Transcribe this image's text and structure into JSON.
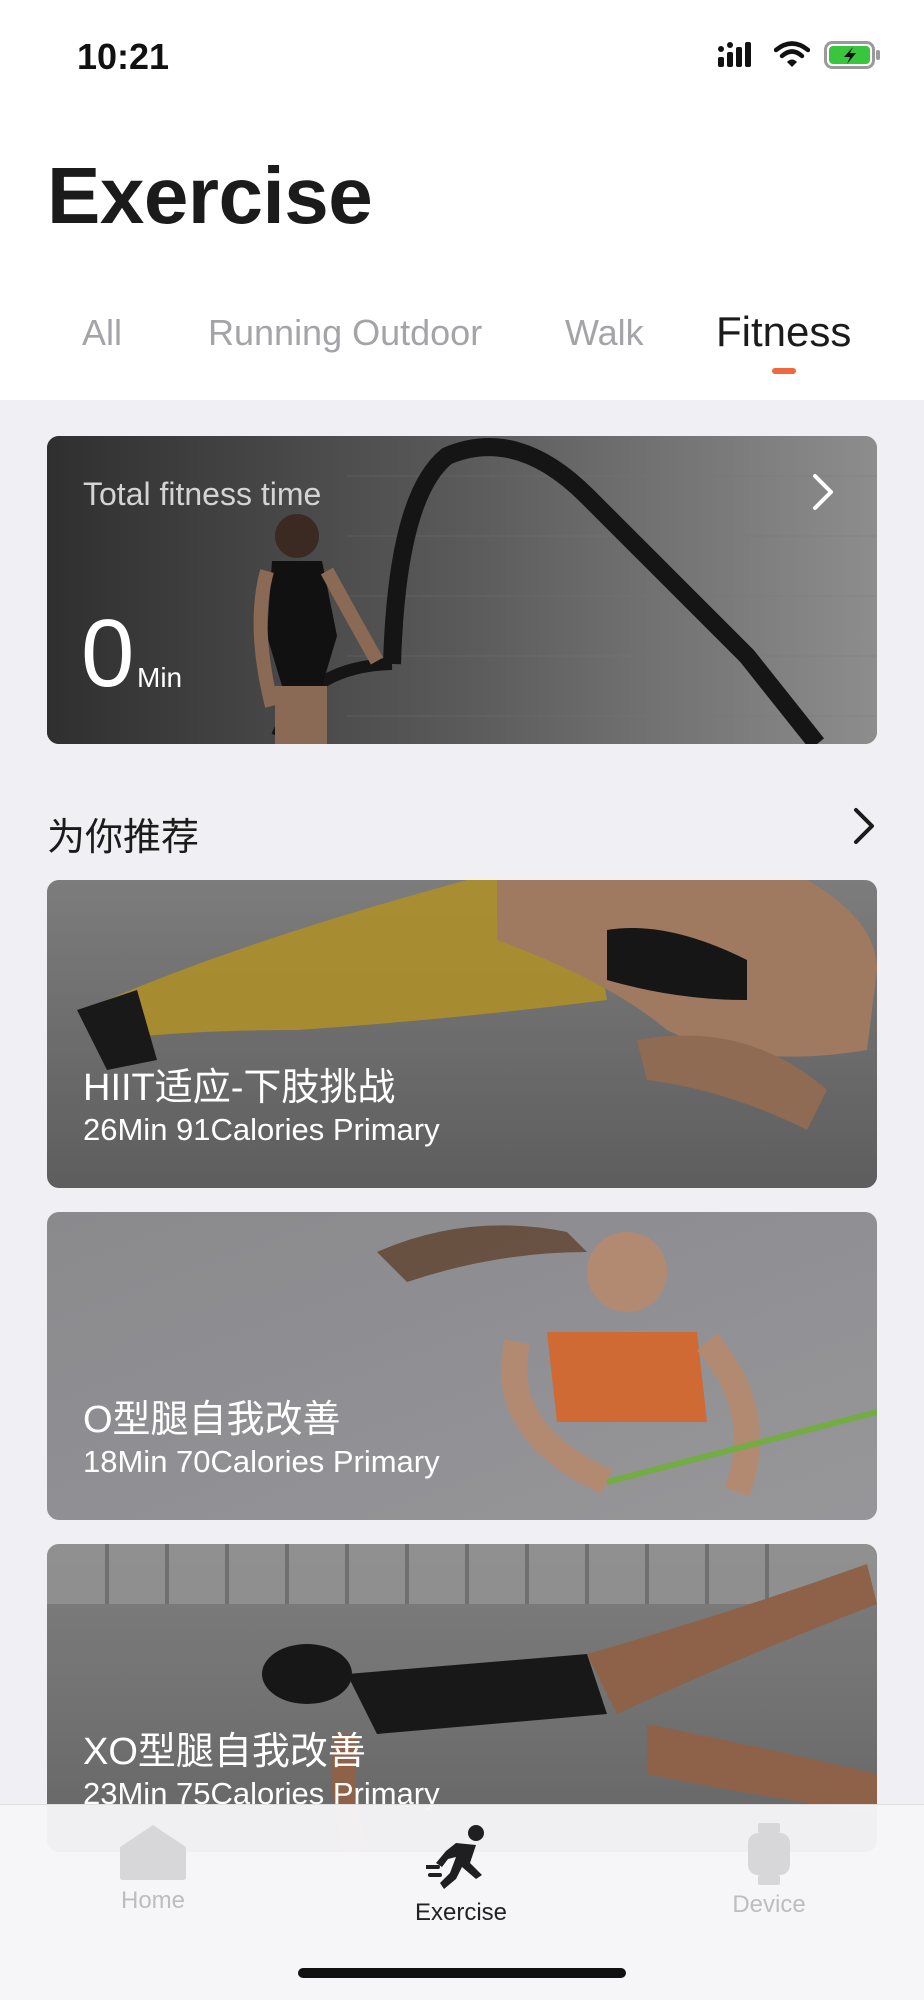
{
  "status_bar": {
    "time": "10:21",
    "icons": [
      "cellular-signal-icon",
      "wifi-icon",
      "battery-charging-icon"
    ],
    "battery_color": "#39c63c"
  },
  "header": {
    "title": "Exercise"
  },
  "tabs": [
    {
      "label": "All",
      "active": false
    },
    {
      "label": "Running Outdoor",
      "active": false
    },
    {
      "label": "Walk",
      "active": false
    },
    {
      "label": "Fitness",
      "active": true
    }
  ],
  "accent_color": "#f2683d",
  "summary": {
    "label": "Total fitness time",
    "value": "0",
    "unit": "Min",
    "icon": "chevron-right-icon"
  },
  "recommend": {
    "title": "为你推荐",
    "icon": "chevron-right-icon",
    "items": [
      {
        "name": "HIIT适应-下肢挑战",
        "meta": "26Min 91Calories Primary"
      },
      {
        "name": "O型腿自我改善",
        "meta": "18Min 70Calories Primary"
      },
      {
        "name": "XO型腿自我改善",
        "meta": "23Min 75Calories Primary"
      }
    ]
  },
  "tabbar": {
    "items": [
      {
        "label": "Home",
        "icon": "home-icon",
        "active": false
      },
      {
        "label": "Exercise",
        "icon": "running-person-icon",
        "active": true
      },
      {
        "label": "Device",
        "icon": "watch-icon",
        "active": false
      }
    ]
  }
}
